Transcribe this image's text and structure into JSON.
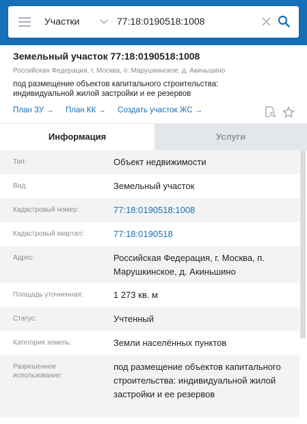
{
  "search": {
    "category": "Участки",
    "query": "77:18:0190518:1008"
  },
  "card": {
    "title": "Земельный участок 77:18:0190518:1008",
    "address": "Российская Федерация, г. Москва, п. Марушкинское, д. Акиньшино",
    "description": "под размещение объектов капитального строительства: индивидуальной жилой застройки и ее резервов",
    "links": [
      "План ЗУ →",
      "План КК →",
      "Создать участок ЖС →"
    ]
  },
  "tabs": [
    "Информация",
    "Услуги"
  ],
  "details": [
    {
      "label": "Тип:",
      "value": "Объект недвижимости"
    },
    {
      "label": "Вид:",
      "value": "Земельный участок"
    },
    {
      "label": "Кадастровый номер:",
      "value": "77:18:0190518:1008"
    },
    {
      "label": "Кадастровый квартал:",
      "value": "77:18:0190518"
    },
    {
      "label": "Адрес:",
      "value": "Российская Федерация, г. Москва, п. Марушкинское, д. Акиньшино"
    },
    {
      "label": "Площадь уточненная:",
      "value": "1 273 кв. м"
    },
    {
      "label": "Статус:",
      "value": "Учтенный"
    },
    {
      "label": "Категория земель:",
      "value": "Земли населённых пунктов"
    },
    {
      "label": "Разрешенное использование:",
      "value": "под размещение объектов капитального строительства: индивидуальной жилой застройки и ее резервов"
    }
  ],
  "colors": {
    "accent": "#1570b8",
    "alt_row": "#f3f3f3",
    "tab_inactive": "#e3e6ea"
  },
  "icons": [
    "menu-icon",
    "chevron-down-icon",
    "clear-icon",
    "search-icon",
    "document-search-icon",
    "star-icon"
  ]
}
